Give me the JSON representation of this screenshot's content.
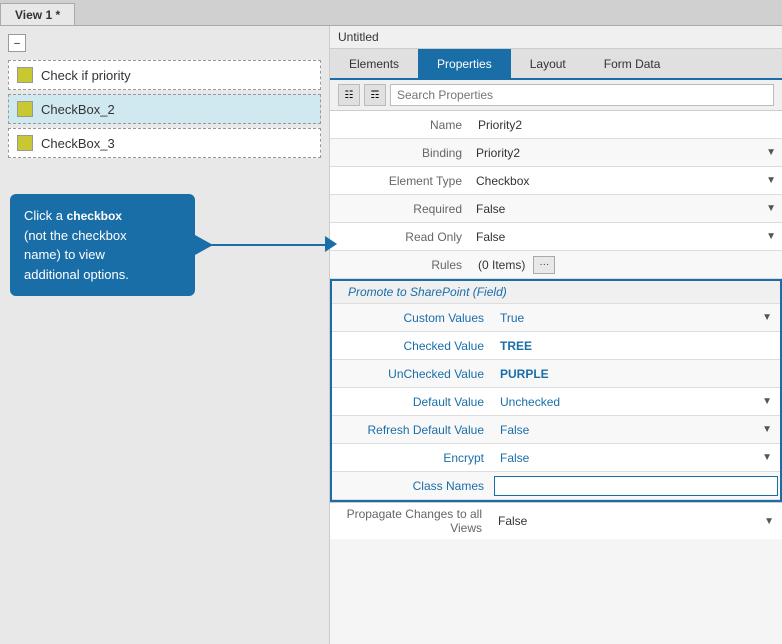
{
  "top_tabs": {
    "active": "View 1 *",
    "items": [
      "View 1 *"
    ]
  },
  "left_panel": {
    "form_items": [
      {
        "id": "item1",
        "label": "Check if priority",
        "selected": false
      },
      {
        "id": "item2",
        "label": "CheckBox_2",
        "selected": true
      },
      {
        "id": "item3",
        "label": "CheckBox_3",
        "selected": false
      }
    ],
    "tooltip": {
      "text_before_bold": "Click a ",
      "bold_text": "checkbox",
      "text_after_bold": "\n(not the checkbox\nname) to view\nadditional options."
    }
  },
  "right_panel": {
    "title": "Untitled",
    "tabs": [
      "Elements",
      "Properties",
      "Layout",
      "Form Data"
    ],
    "active_tab": "Properties",
    "search_placeholder": "Search Properties",
    "properties": [
      {
        "label": "Name",
        "value": "Priority2",
        "type": "text"
      },
      {
        "label": "Binding",
        "value": "Priority2",
        "type": "select"
      },
      {
        "label": "Element Type",
        "value": "Checkbox",
        "type": "select"
      },
      {
        "label": "Required",
        "value": "False",
        "type": "select"
      },
      {
        "label": "Read Only",
        "value": "False",
        "type": "select"
      },
      {
        "label": "Rules",
        "value": "(0 Items)",
        "type": "rules"
      }
    ],
    "promote_section": {
      "header": "Promote to SharePoint (Field)",
      "properties": [
        {
          "label": "Custom Values",
          "value": "True",
          "type": "select"
        },
        {
          "label": "Checked Value",
          "value": "TREE",
          "type": "text"
        },
        {
          "label": "UnChecked Value",
          "value": "PURPLE",
          "type": "text"
        },
        {
          "label": "Default Value",
          "value": "Unchecked",
          "type": "select"
        },
        {
          "label": "Refresh Default Value",
          "value": "False",
          "type": "select"
        },
        {
          "label": "Encrypt",
          "value": "False",
          "type": "select"
        },
        {
          "label": "Class Names",
          "value": "",
          "type": "input"
        }
      ]
    },
    "propagate": {
      "label": "Propagate Changes to all Views",
      "value": "False",
      "type": "select"
    }
  }
}
